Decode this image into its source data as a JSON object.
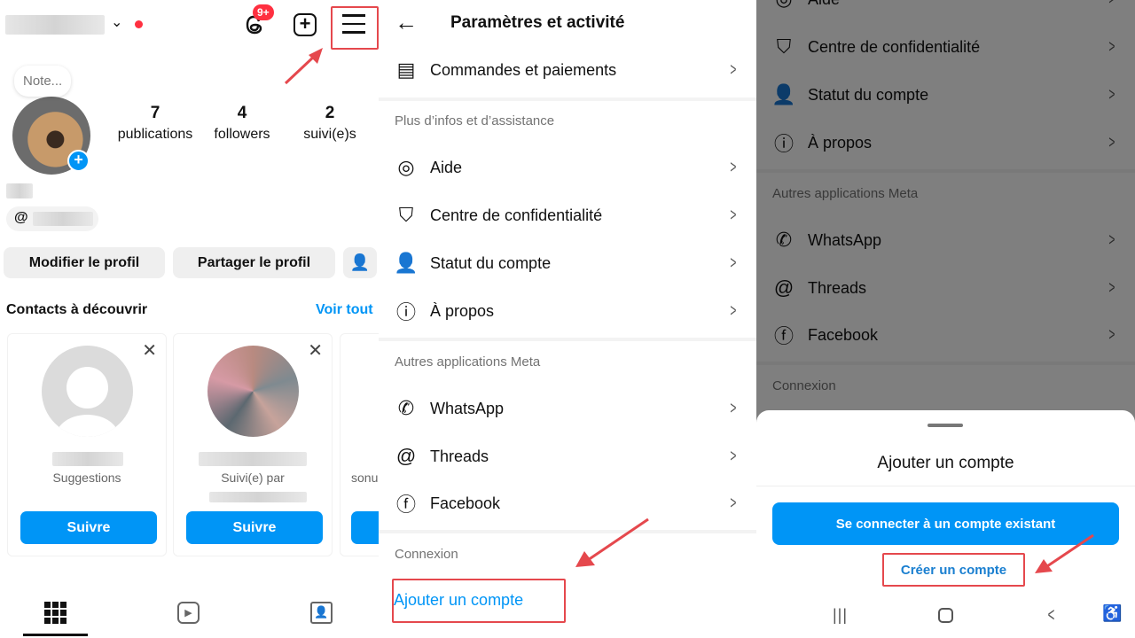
{
  "profile": {
    "notifications_badge": "9+",
    "note_placeholder": "Note...",
    "stats": [
      {
        "value": "7",
        "label": "publications"
      },
      {
        "value": "4",
        "label": "followers"
      },
      {
        "value": "2",
        "label": "suivi(e)s"
      }
    ],
    "edit_profile": "Modifier le profil",
    "share_profile": "Partager le profil",
    "discover_title": "Contacts à découvrir",
    "see_all": "Voir tout",
    "cards": [
      {
        "subtitle": "Suggestions",
        "follow": "Suivre"
      },
      {
        "subtitle": "Suivi(e) par",
        "follow": "Suivre"
      },
      {
        "subtitle": "sonu",
        "follow": ""
      }
    ]
  },
  "settings": {
    "title": "Paramètres et activité",
    "items_top": [
      {
        "label": "Commandes et paiements",
        "icon": "orders-icon"
      }
    ],
    "section_help": "Plus d’infos et d’assistance",
    "items_help": [
      {
        "label": "Aide",
        "icon": "help-lifebuoy-icon"
      },
      {
        "label": "Centre de confidentialité",
        "icon": "shield-star-icon"
      },
      {
        "label": "Statut du compte",
        "icon": "person-icon"
      },
      {
        "label": "À propos",
        "icon": "info-icon"
      }
    ],
    "section_meta": "Autres applications Meta",
    "items_meta": [
      {
        "label": "WhatsApp",
        "icon": "whatsapp-icon"
      },
      {
        "label": "Threads",
        "icon": "threads-icon"
      },
      {
        "label": "Facebook",
        "icon": "facebook-icon"
      }
    ],
    "section_login": "Connexion",
    "add_account": "Ajouter un compte"
  },
  "sheet": {
    "title": "Ajouter un compte",
    "login_existing": "Se connecter à un compte existant",
    "create_account": "Créer un compte"
  },
  "colors": {
    "accent": "#0095f6",
    "highlight": "#e5484d",
    "badge": "#ff3040"
  }
}
